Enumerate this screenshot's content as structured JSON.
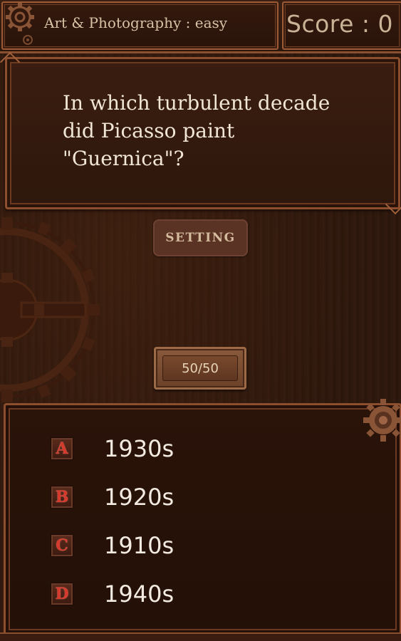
{
  "header": {
    "category": "Art & Photography : easy",
    "score": "Score : 0"
  },
  "question": {
    "text": "In which turbulent decade did Picasso paint \"Guernica\"?"
  },
  "buttons": {
    "setting": "SETTING",
    "lifeline": "50/50"
  },
  "answers": [
    {
      "letter": "A",
      "text": "1930s"
    },
    {
      "letter": "B",
      "text": "1920s"
    },
    {
      "letter": "C",
      "text": "1910s"
    },
    {
      "letter": "D",
      "text": "1940s"
    }
  ],
  "colors": {
    "frame": "#8c4e2c",
    "text": "#f1e6d6",
    "badge_letter": "#d63a2c"
  }
}
